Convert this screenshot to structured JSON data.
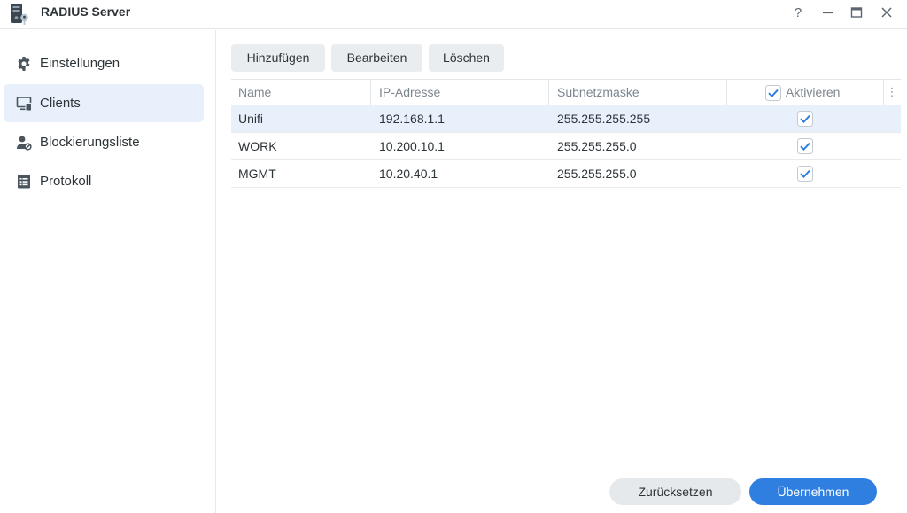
{
  "window": {
    "title": "RADIUS Server",
    "controls": {
      "help": "?",
      "minimize": "—",
      "maximize": "▭",
      "close": "✕"
    }
  },
  "sidebar": {
    "items": [
      {
        "label": "Einstellungen",
        "icon": "gear-icon",
        "active": false
      },
      {
        "label": "Clients",
        "icon": "monitor-icon",
        "active": true
      },
      {
        "label": "Blockierungsliste",
        "icon": "user-block-icon",
        "active": false
      },
      {
        "label": "Protokoll",
        "icon": "log-icon",
        "active": false
      }
    ]
  },
  "toolbar": {
    "add_label": "Hinzufügen",
    "edit_label": "Bearbeiten",
    "delete_label": "Löschen"
  },
  "table": {
    "columns": {
      "name": "Name",
      "ip": "IP-Adresse",
      "subnet": "Subnetzmaske",
      "enabled": "Aktivieren"
    },
    "rows": [
      {
        "name": "Unifi",
        "ip": "192.168.1.1",
        "subnet": "255.255.255.255",
        "enabled": true,
        "selected": true
      },
      {
        "name": "WORK",
        "ip": "10.200.10.1",
        "subnet": "255.255.255.0",
        "enabled": true,
        "selected": false
      },
      {
        "name": "MGMT",
        "ip": "10.20.40.1",
        "subnet": "255.255.255.0",
        "enabled": true,
        "selected": false
      }
    ]
  },
  "footer": {
    "reset_label": "Zurücksetzen",
    "apply_label": "Übernehmen"
  },
  "colors": {
    "accent": "#2f7fe0",
    "selection": "#e8f0fb",
    "checkmark": "#2f7fe0"
  }
}
